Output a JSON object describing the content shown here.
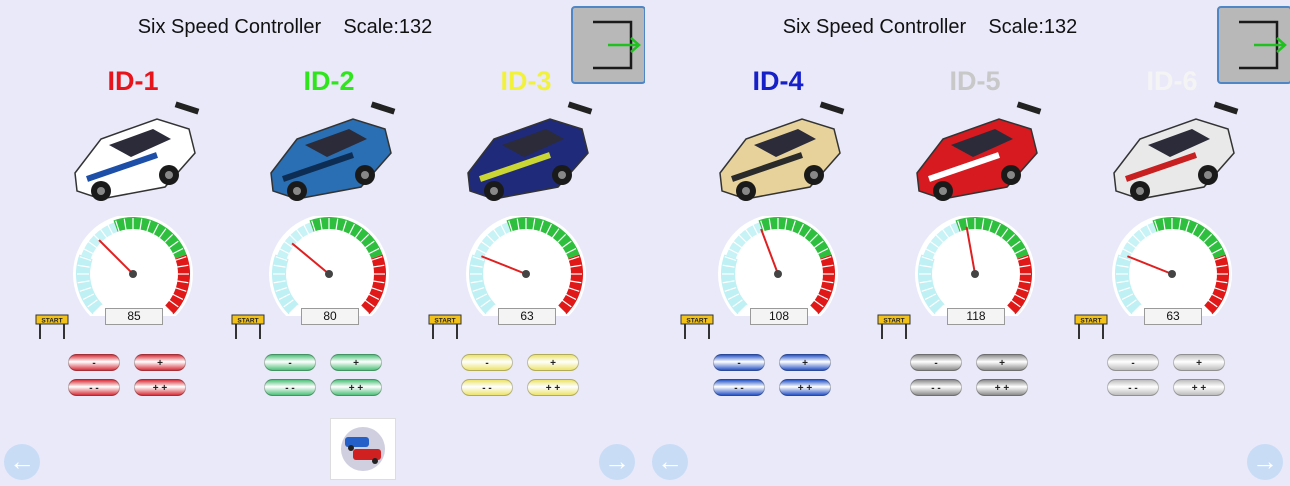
{
  "left_panel": {
    "title": "Six Speed Controller    Scale:132",
    "cars": [
      {
        "id_label": "ID-1",
        "id_color": "#e8141c",
        "speed": "85",
        "btn_color": "#d8323c",
        "car_color": "#ffffff",
        "accent": "#1d4fa8"
      },
      {
        "id_label": "ID-2",
        "id_color": "#2ee61b",
        "speed": "80",
        "btn_color": "#4fc07a",
        "car_color": "#2a6fb3",
        "accent": "#0d2d55"
      },
      {
        "id_label": "ID-3",
        "id_color": "#f2f23a",
        "speed": "63",
        "btn_color": "#ece36b",
        "car_color": "#1f2a7a",
        "accent": "#c9d634"
      }
    ]
  },
  "right_panel": {
    "title": "Six Speed Controller    Scale:132",
    "cars": [
      {
        "id_label": "ID-4",
        "id_color": "#1520c8",
        "speed": "108",
        "btn_color": "#2b56c7",
        "car_color": "#e6d29a",
        "accent": "#2a2a2a"
      },
      {
        "id_label": "ID-5",
        "id_color": "#c8c8c8",
        "speed": "118",
        "btn_color": "#8c8c8c",
        "car_color": "#d61a1f",
        "accent": "#ffffff"
      },
      {
        "id_label": "ID-6",
        "id_color": "#f4f4f4",
        "speed": "63",
        "btn_color": "#bdbdbd",
        "car_color": "#e9e9e9",
        "accent": "#c82020"
      }
    ]
  },
  "buttons": {
    "minus": "-",
    "plus": "+",
    "minus2": "- -",
    "plus2": "+ +"
  },
  "sign_text": "START",
  "icons": {
    "exit": "exit-icon",
    "back": "arrow-left-icon",
    "forward": "arrow-right-icon"
  }
}
